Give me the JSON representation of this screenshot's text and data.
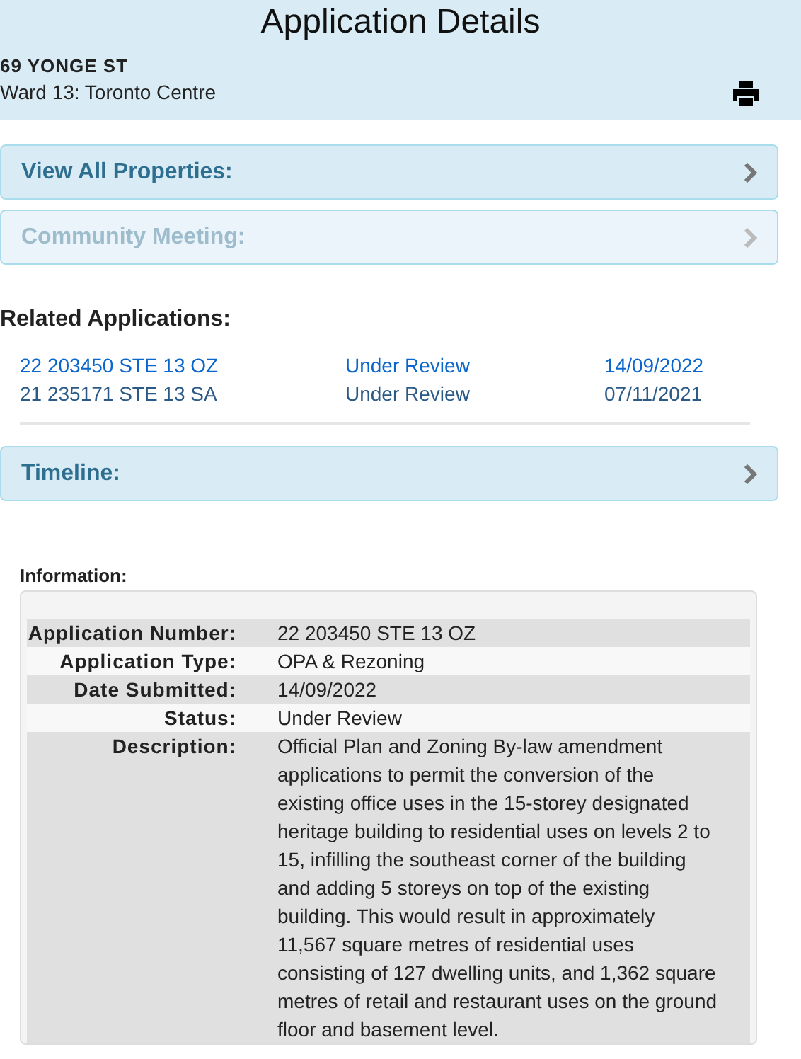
{
  "header": {
    "title": "Application Details",
    "address": "69 YONGE ST",
    "ward": "Ward 13: Toronto Centre"
  },
  "sections_top": [
    {
      "label": "View All Properties:",
      "disabled": false
    },
    {
      "label": "Community Meeting:",
      "disabled": true
    }
  ],
  "related": {
    "heading": "Related Applications:",
    "rows": [
      {
        "number": "22 203450 STE 13 OZ",
        "status": "Under Review",
        "date": "14/09/2022",
        "selected": true
      },
      {
        "number": "21 235171 STE 13 SA",
        "status": "Under Review",
        "date": "07/11/2021",
        "selected": false
      }
    ]
  },
  "sections_bottom": [
    {
      "label": "Timeline:",
      "disabled": false
    }
  ],
  "information": {
    "heading": "Information:",
    "rows": [
      {
        "label": "Application Number:",
        "value": "22 203450 STE 13 OZ"
      },
      {
        "label": "Application Type:",
        "value": "OPA & Rezoning"
      },
      {
        "label": "Date Submitted:",
        "value": "14/09/2022"
      },
      {
        "label": "Status:",
        "value": "Under Review"
      },
      {
        "label": "Description:",
        "value": "Official Plan and Zoning By-law amendment applications to permit the conversion of the existing office uses in the 15-storey designated heritage building to residential uses on levels 2 to 15, infilling the southeast corner of the building and adding 5 storeys on top of the existing building. This would result in approximately 11,567 square metres of residential uses consisting of 127 dwelling units, and 1,362 square metres of retail and restaurant uses on the ground floor and basement level."
      }
    ]
  }
}
